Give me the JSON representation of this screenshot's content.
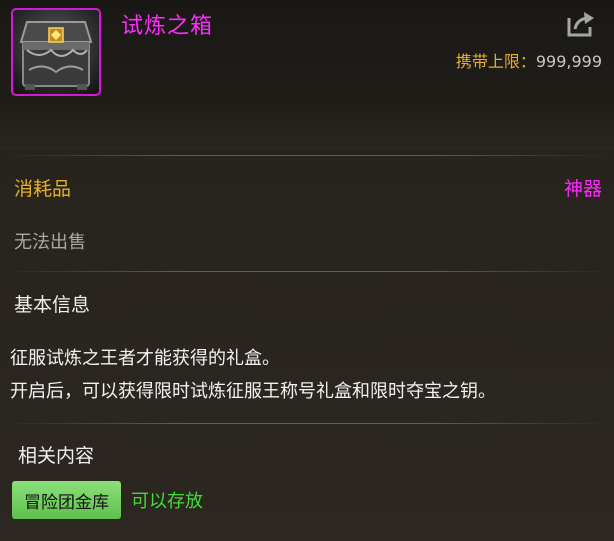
{
  "item": {
    "title": "试炼之箱",
    "carry_limit_label": "携带上限：",
    "carry_limit_value": "999,999",
    "icon": "treasure-chest-icon"
  },
  "info": {
    "type": "消耗品",
    "rarity": "神器",
    "sell_status": "无法出售"
  },
  "basic": {
    "heading": "基本信息",
    "lines": [
      "征服试炼之王者才能获得的礼盒。",
      "开启后，可以获得限时试炼征服王称号礼盒和限时夺宝之钥。"
    ]
  },
  "related": {
    "heading": "相关内容",
    "tag_label": "冒险团金库",
    "tag_desc": "可以存放"
  },
  "colors": {
    "rarity_epic": "#ff2bff",
    "gold": "#e6b02a",
    "green": "#43dc3a",
    "tag_bg": "#6fcf5c"
  }
}
